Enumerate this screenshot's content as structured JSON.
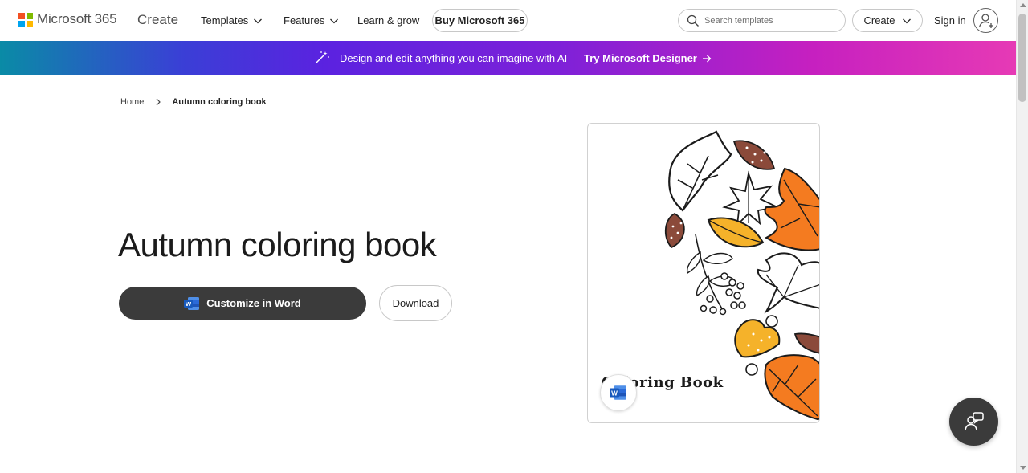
{
  "header": {
    "brand": "Microsoft 365",
    "section": "Create",
    "nav": {
      "templates": "Templates",
      "features": "Features",
      "learn": "Learn & grow",
      "buy": "Buy Microsoft 365"
    },
    "search_placeholder": "Search templates",
    "create_menu": "Create",
    "sign_in": "Sign in"
  },
  "banner": {
    "text": "Design and edit anything you can imagine with AI",
    "link": "Try Microsoft Designer"
  },
  "breadcrumb": {
    "home": "Home",
    "current": "Autumn coloring book"
  },
  "hero": {
    "title": "Autumn coloring book",
    "customize_label": "Customize in Word",
    "download_label": "Download"
  },
  "preview": {
    "caption": "Coloring Book",
    "app_icon": "word-icon"
  },
  "colors": {
    "brand_red": "#f25022",
    "brand_green": "#7fba00",
    "brand_blue": "#00a4ef",
    "brand_yellow": "#ffb900",
    "dark_button": "#3b3b3b",
    "leaf_orange": "#f47b20",
    "leaf_brown": "#8b4a3a",
    "leaf_yellow": "#f5b22a"
  }
}
